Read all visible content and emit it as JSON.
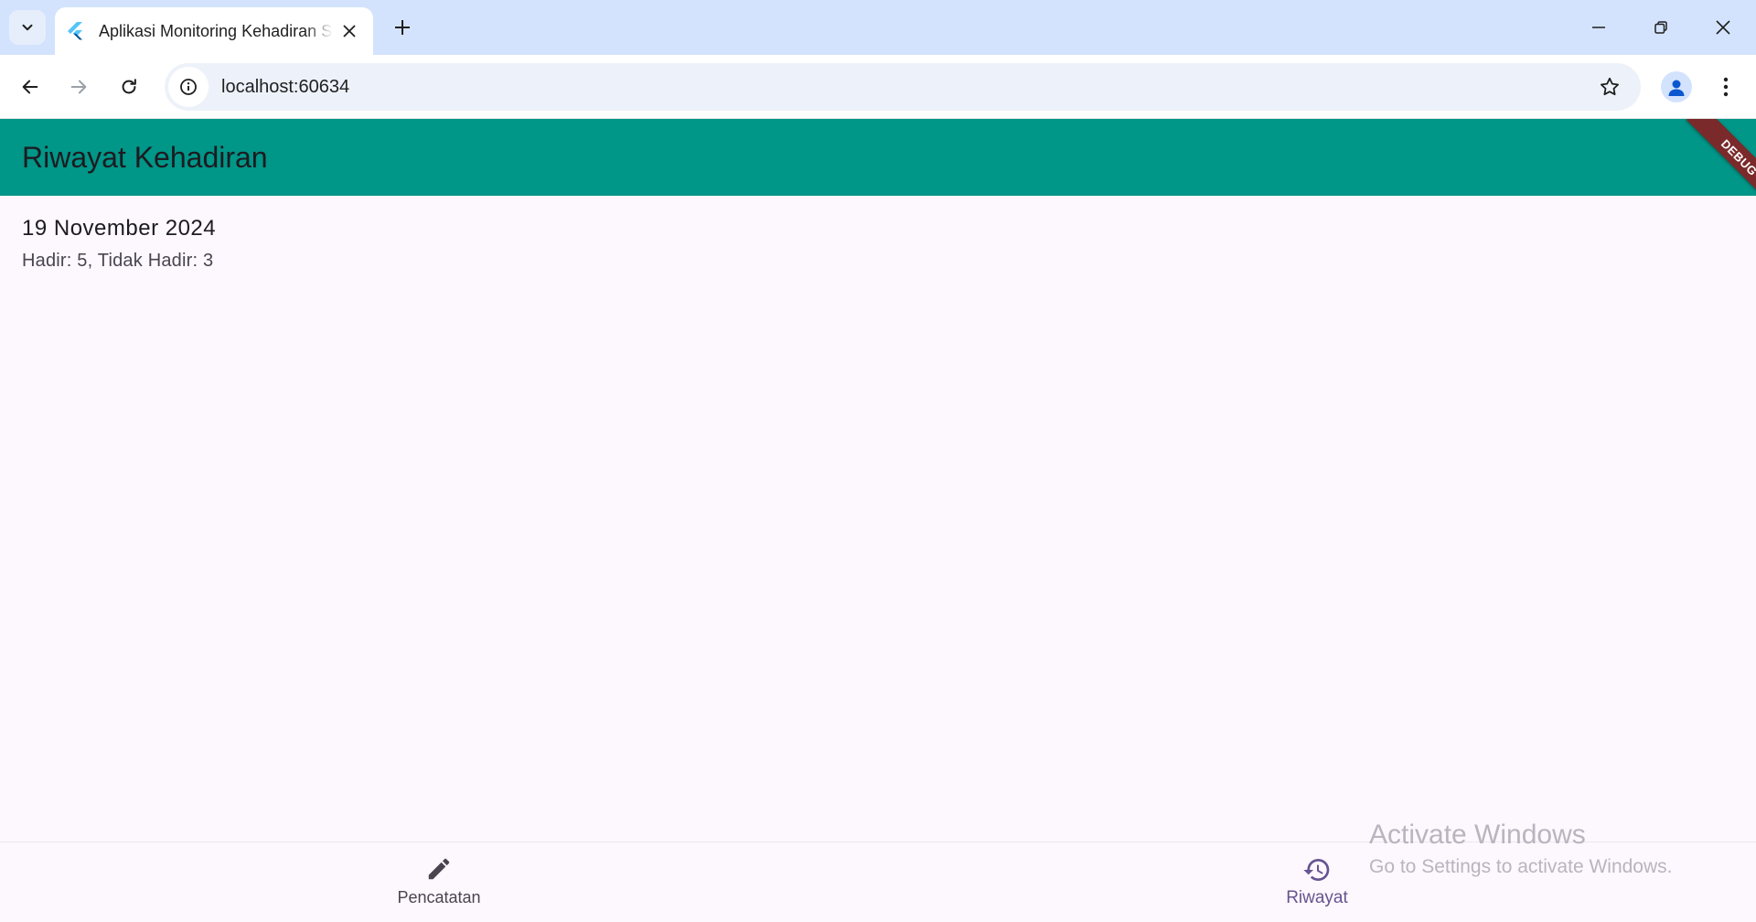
{
  "browser": {
    "tab_title": "Aplikasi Monitoring Kehadiran Siswa",
    "url": "localhost:60634"
  },
  "app": {
    "title": "Riwayat Kehadiran",
    "debug_label": "DEBUG",
    "records": [
      {
        "date": "19 November 2024",
        "summary": "Hadir: 5, Tidak Hadir: 3"
      }
    ],
    "bottom_nav": [
      {
        "label": "Pencatatan",
        "icon": "edit-icon",
        "selected": false
      },
      {
        "label": "Riwayat",
        "icon": "history-icon",
        "selected": true
      }
    ]
  },
  "os_overlay": {
    "title": "Activate Windows",
    "subtitle": "Go to Settings to activate Windows."
  },
  "colors": {
    "appbar": "#009688",
    "background": "#fdf7fe",
    "nav_selected": "#65558f",
    "nav_unselected": "#49454f",
    "debug_ribbon": "#7a2a2a"
  }
}
